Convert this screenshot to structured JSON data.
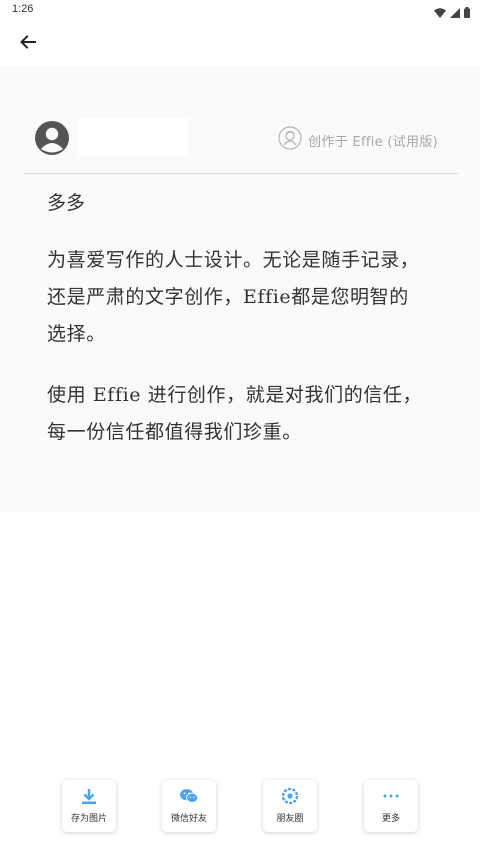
{
  "status_bar": {
    "time": "1:26",
    "icons": [
      "wifi-icon",
      "signal-icon",
      "battery-icon"
    ]
  },
  "top_bar": {
    "back_icon": "arrow-left-icon"
  },
  "card": {
    "app_credit": "创作于 Effie (试用版)",
    "title": "多多",
    "paragraphs": [
      "为喜爱写作的人士设计。无论是随手记录，还是严肃的文字创作，Effie都是您明智的选择。",
      "使用 Effie 进行创作，就是对我们的信任，每一份信任都值得我们珍重。"
    ]
  },
  "share": {
    "save_image": "存为图片",
    "wechat_friend": "微信好友",
    "moments": "朋友圈",
    "more": "更多"
  },
  "colors": {
    "accent": "#4aa3f0",
    "card_bg": "#fafafa",
    "text": "#333333",
    "muted": "#a7a7a7"
  }
}
